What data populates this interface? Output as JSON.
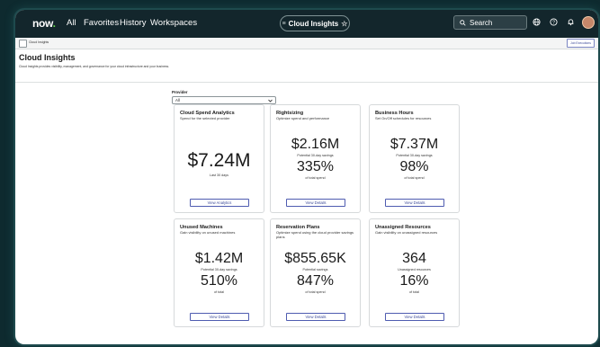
{
  "nav": {
    "logo": "now",
    "links": [
      "All",
      "Favorites",
      "History",
      "Workspaces"
    ],
    "app_pill": "Cloud Insights",
    "search_label": "Search"
  },
  "tabbar": {
    "tab_label": "Cloud Insights",
    "job_button": "Job Executions"
  },
  "page": {
    "title": "Cloud Insights",
    "subtitle": "Cloud Insights provides visibility, management, and governance for your cloud infrastructure and your business."
  },
  "filter": {
    "label": "Provider",
    "value": "All"
  },
  "cards": [
    {
      "title": "Cloud Spend Analytics",
      "subtitle": "Spend for the selected provider",
      "big1": "$7.24M",
      "cap1": "Last 30 days",
      "button": "View Analytics"
    },
    {
      "title": "Rightsizing",
      "subtitle": "Optimize spend and performance",
      "big1": "$2.16M",
      "cap1": "Potential 30-day savings",
      "big2": "335%",
      "cap2": "of total spend",
      "button": "View Details"
    },
    {
      "title": "Business Hours",
      "subtitle": "Set On/Off schedules for resources",
      "big1": "$7.37M",
      "cap1": "Potential 30-day savings",
      "big2": "98%",
      "cap2": "of total spend",
      "button": "View Details"
    },
    {
      "title": "Unused Machines",
      "subtitle": "Gain visibility on unused machines",
      "big1": "$1.42M",
      "cap1": "Potential 30-day savings",
      "big2": "510%",
      "cap2": "of total",
      "button": "View Details"
    },
    {
      "title": "Reservation Plans",
      "subtitle": "Optimize spend using the cloud provider savings plans",
      "big1": "$855.65K",
      "cap1": "Potential savings",
      "big2": "847%",
      "cap2": "of total spend",
      "button": "View Details"
    },
    {
      "title": "Unassigned Resources",
      "subtitle": "Gain visibility on unassigned resources",
      "big1": "364",
      "cap1": "Unassigned resources",
      "big2": "16%",
      "cap2": "of total",
      "button": "View Details"
    }
  ],
  "colors": {
    "nav_bg": "#13262c",
    "accent": "#3c4a9a",
    "logo_dot": "#62d84e"
  },
  "icons": [
    "menu-icon",
    "star-icon",
    "search-icon",
    "globe-icon",
    "help-icon",
    "bell-icon",
    "avatar"
  ]
}
